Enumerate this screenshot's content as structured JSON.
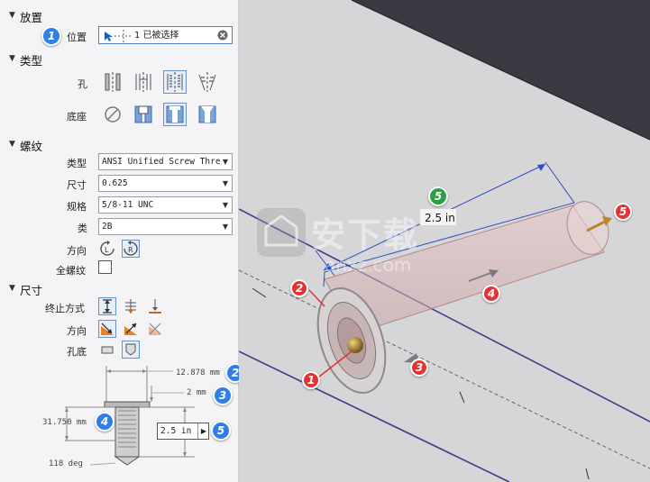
{
  "placement": {
    "section": "放置",
    "position_label": "位置",
    "position_value": "1 已被选择"
  },
  "type": {
    "section": "类型",
    "hole_label": "孔",
    "seat_label": "底座"
  },
  "thread": {
    "section": "螺纹",
    "type_label": "类型",
    "type_value": "ANSI Unified Screw Thre",
    "size_label": "尺寸",
    "size_value": "0.625",
    "spec_label": "规格",
    "spec_value": "5/8-11 UNC",
    "class_label": "类",
    "class_value": "2B",
    "direction_label": "方向",
    "full_thread_label": "全螺纹",
    "full_thread_checked": false
  },
  "dimensions": {
    "section": "尺寸",
    "termination_label": "终止方式",
    "direction_label": "方向",
    "hole_bottom_label": "孔底"
  },
  "diagram": {
    "dim_top": "12.878 mm",
    "dim_offset": "2 mm",
    "dim_depth": "31.750 mm",
    "dim_input": "2.5 in",
    "dim_angle": "118 deg"
  },
  "viewport": {
    "dim_label": "2.5 in",
    "watermark_text": "安下载",
    "watermark_url": "anxz.com"
  },
  "callouts": {
    "b1": "1",
    "b2": "2",
    "b3": "3",
    "b4": "4",
    "b5": "5",
    "r1": "1",
    "r2": "2",
    "r3": "3",
    "r4": "4",
    "r5": "5",
    "g5": "5"
  },
  "colors": {
    "callout_blue": "#2f7fe6",
    "callout_red": "#e53232",
    "callout_green": "#27a244",
    "selection_blue": "#6b8fc7",
    "viewport_bg": "#3c3c44",
    "part_face": "#d8d8db"
  }
}
